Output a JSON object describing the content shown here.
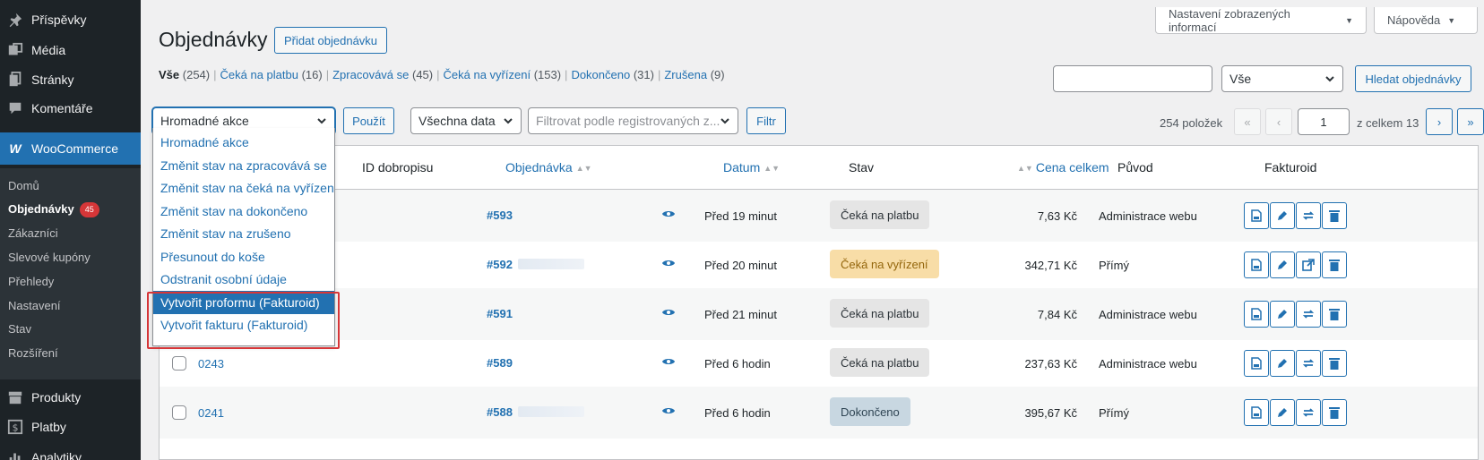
{
  "sidebar": {
    "top_items": [
      {
        "label": "Příspěvky",
        "icon": "pushpin-icon"
      },
      {
        "label": "Média",
        "icon": "media-icon"
      },
      {
        "label": "Stránky",
        "icon": "pages-icon"
      },
      {
        "label": "Komentáře",
        "icon": "comment-icon"
      }
    ],
    "woocommerce": {
      "label": "WooCommerce",
      "icon": "woocommerce-icon"
    },
    "submenu": [
      {
        "label": "Domů"
      },
      {
        "label": "Objednávky",
        "badge": "45"
      },
      {
        "label": "Zákazníci"
      },
      {
        "label": "Slevové kupóny"
      },
      {
        "label": "Přehledy"
      },
      {
        "label": "Nastavení"
      },
      {
        "label": "Stav"
      },
      {
        "label": "Rozšíření"
      }
    ],
    "bottom_items": [
      {
        "label": "Produkty",
        "icon": "products-icon"
      },
      {
        "label": "Platby",
        "icon": "payments-icon"
      },
      {
        "label": "Analytiky",
        "icon": "analytics-icon"
      }
    ]
  },
  "screen_meta": {
    "options_label": "Nastavení zobrazených informací",
    "help_label": "Nápověda"
  },
  "header": {
    "title": "Objednávky",
    "add_button": "Přidat objednávku"
  },
  "status_filters": [
    {
      "label": "Vše",
      "count": "(254)"
    },
    {
      "label": "Čeká na platbu",
      "count": "(16)"
    },
    {
      "label": "Zpracovává se",
      "count": "(45)"
    },
    {
      "label": "Čeká na vyřízení",
      "count": "(153)"
    },
    {
      "label": "Dokončeno",
      "count": "(31)"
    },
    {
      "label": "Zrušena",
      "count": "(9)"
    }
  ],
  "search": {
    "value": "",
    "type_select": "Vše",
    "button": "Hledat objednávky"
  },
  "tablenav": {
    "bulk_select": "Hromadné akce",
    "apply_button": "Použít",
    "date_select": "Všechna data",
    "customer_filter_placeholder": "Filtrovat podle registrovaných z...",
    "filter_button": "Filtr",
    "items_count": "254 položek",
    "first": "«",
    "prev": "‹",
    "current_page": "1",
    "total_pages_text": "z celkem 13",
    "next": "›",
    "last": "»"
  },
  "bulk_menu": [
    "Hromadné akce",
    "Změnit stav na zpracovává se",
    "Změnit stav na čeká na vyřízení",
    "Změnit stav na dokončeno",
    "Změnit stav na zrušeno",
    "Přesunout do koše",
    "Odstranit osobní údaje",
    "Vytvořit proformu (Fakturoid)",
    "Vytvořit fakturu (Fakturoid)"
  ],
  "bulk_menu_selected": 7,
  "table": {
    "headers": {
      "credit_note_id": "ID dobropisu",
      "order": "Objednávka",
      "date": "Datum",
      "status": "Stav",
      "total": "Cena celkem",
      "origin": "Původ",
      "fakturoid": "Fakturoid"
    },
    "rows": [
      {
        "credit_id": "",
        "order": "#593",
        "date": "Před 19 minut",
        "status": "Čeká na platbu",
        "status_type": "pending",
        "total": "7,63 Kč",
        "origin": "Administrace webu"
      },
      {
        "credit_id": "",
        "order": "#592",
        "date": "Před 20 minut",
        "status": "Čeká na vyřízení",
        "status_type": "processing",
        "total": "342,71 Kč",
        "origin": "Přímý"
      },
      {
        "credit_id": "",
        "order": "#591",
        "date": "Před 21 minut",
        "status": "Čeká na platbu",
        "status_type": "pending",
        "total": "7,84 Kč",
        "origin": "Administrace webu"
      },
      {
        "credit_id": "0243",
        "order": "#589",
        "date": "Před 6 hodin",
        "status": "Čeká na platbu",
        "status_type": "pending",
        "total": "237,63 Kč",
        "origin": "Administrace webu"
      },
      {
        "credit_id": "0241",
        "order": "#588",
        "date": "Před 6 hodin",
        "status": "Dokončeno",
        "status_type": "completed",
        "total": "395,67 Kč",
        "origin": "Přímý"
      }
    ]
  }
}
